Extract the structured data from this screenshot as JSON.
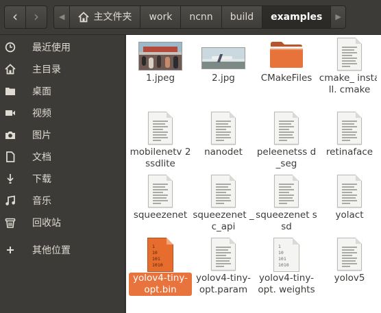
{
  "toolbar": {
    "back_icon": "chevron-left-icon",
    "forward_icon": "chevron-right-icon",
    "breadcrumb": [
      "主文件夹",
      "work",
      "ncnn",
      "build",
      "examples"
    ],
    "home_icon": "home-icon"
  },
  "sidebar": {
    "items": [
      {
        "label": "最近使用",
        "icon": "clock-icon"
      },
      {
        "label": "主目录",
        "icon": "home-icon"
      },
      {
        "label": "桌面",
        "icon": "folder-icon"
      },
      {
        "label": "视频",
        "icon": "video-icon"
      },
      {
        "label": "图片",
        "icon": "camera-icon"
      },
      {
        "label": "文档",
        "icon": "document-icon"
      },
      {
        "label": "下载",
        "icon": "download-icon"
      },
      {
        "label": "音乐",
        "icon": "music-icon"
      },
      {
        "label": "回收站",
        "icon": "trash-icon"
      },
      {
        "label": "其他位置",
        "icon": "plus-icon"
      }
    ]
  },
  "files": [
    {
      "name": "1.jpeg",
      "type": "image"
    },
    {
      "name": "2.jpg",
      "type": "image"
    },
    {
      "name": "CMakeFiles",
      "type": "folder"
    },
    {
      "name": "cmake_ install. cmake",
      "type": "text"
    },
    {
      "name": "mobilenetv 2ssdlite",
      "type": "text"
    },
    {
      "name": "nanodet",
      "type": "text"
    },
    {
      "name": "peleenetss d_seg",
      "type": "text"
    },
    {
      "name": "retinaface",
      "type": "text"
    },
    {
      "name": "squeezenet",
      "type": "text"
    },
    {
      "name": "squeezenet _c_api",
      "type": "text"
    },
    {
      "name": "squeezenet ssd",
      "type": "text"
    },
    {
      "name": "yolact",
      "type": "text"
    },
    {
      "name": "yolov4-tiny- opt.bin",
      "type": "binary",
      "selected": true
    },
    {
      "name": "yolov4-tiny- opt.param",
      "type": "text"
    },
    {
      "name": "yolov4-tiny- opt. weights",
      "type": "binary"
    },
    {
      "name": "yolov5",
      "type": "text"
    }
  ],
  "binary_glyph": [
    "1",
    "10",
    "101",
    "1010"
  ],
  "colors": {
    "selection": "#e9733d",
    "sidebar_bg": "#3c3b37",
    "content_bg": "#ffffff"
  }
}
